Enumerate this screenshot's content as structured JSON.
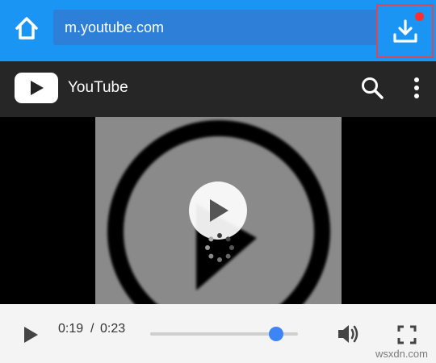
{
  "browser": {
    "url": "m.youtube.com",
    "accent_color": "#1a95f4",
    "url_field_color": "#2d7fd8",
    "home_icon": "home-icon",
    "download_icon": "download-icon",
    "download_badge_color": "#ff2d2d"
  },
  "youtube": {
    "title": "YouTube",
    "logo_icon": "youtube-play-logo",
    "search_icon": "search-icon",
    "menu_icon": "more-vertical-icon"
  },
  "player": {
    "current_time": "0:19",
    "separator": "/",
    "duration": "0:23",
    "progress": 0.85,
    "knob_color": "#3d84f6",
    "play_icon": "play-icon",
    "volume_icon": "volume-icon",
    "fullscreen_icon": "fullscreen-icon"
  },
  "watermark": "wsxdn.com"
}
